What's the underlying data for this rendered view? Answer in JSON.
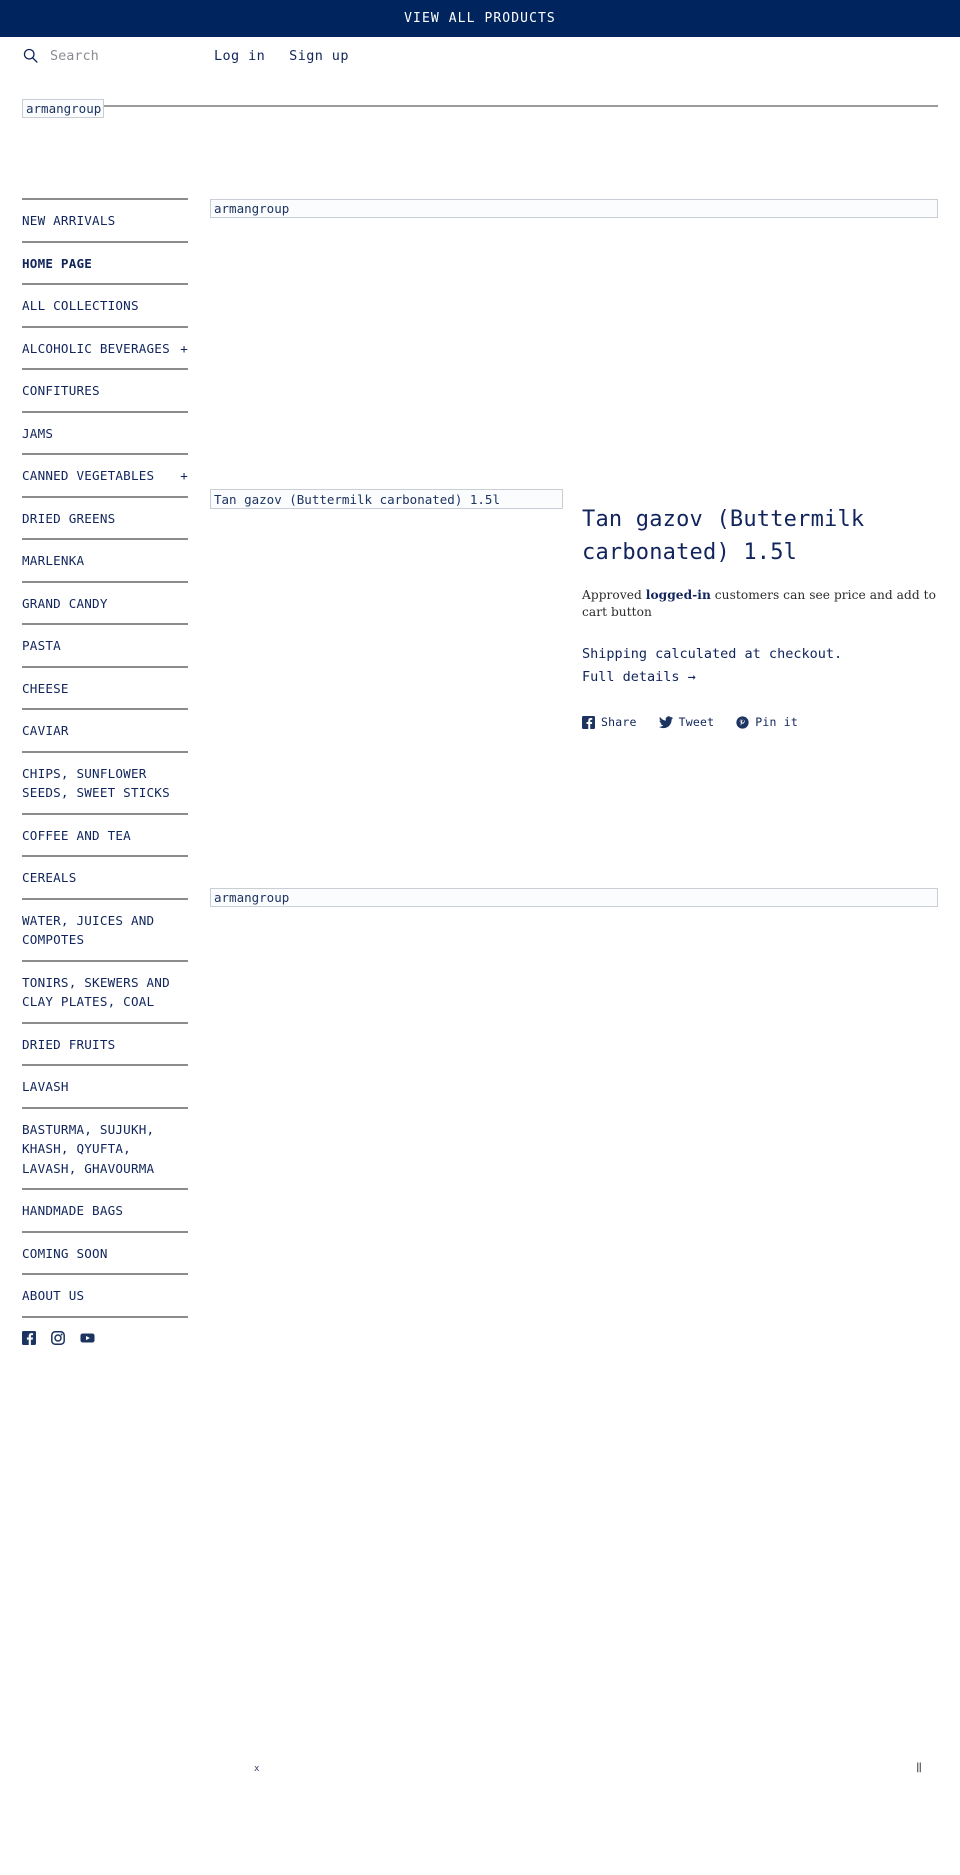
{
  "announcement": {
    "label": "VIEW ALL PRODUCTS"
  },
  "header": {
    "search_placeholder": "Search",
    "search_value": "",
    "search_icon": "search-icon",
    "login_label": "Log in",
    "signup_label": "Sign up",
    "logo_alt": "armangroup"
  },
  "sidebar": {
    "items": [
      {
        "label": "NEW ARRIVALS",
        "expand": "",
        "active": false
      },
      {
        "label": "HOME PAGE",
        "expand": "",
        "active": true
      },
      {
        "label": "ALL COLLECTIONS",
        "expand": "",
        "active": false
      },
      {
        "label": "ALCOHOLIC BEVERAGES",
        "expand": "+",
        "tight": true,
        "active": false
      },
      {
        "label": "CONFITURES",
        "expand": "",
        "active": false
      },
      {
        "label": "JAMS",
        "expand": "",
        "active": false
      },
      {
        "label": "CANNED VEGETABLES",
        "expand": "+",
        "tight": false,
        "active": false
      },
      {
        "label": "DRIED GREENS",
        "expand": "",
        "active": false
      },
      {
        "label": "MARLENKA",
        "expand": "",
        "active": false
      },
      {
        "label": "GRAND CANDY",
        "expand": "",
        "active": false
      },
      {
        "label": "PASTA",
        "expand": "",
        "active": false
      },
      {
        "label": "CHEESE",
        "expand": "",
        "active": false
      },
      {
        "label": "CAVIAR",
        "expand": "",
        "active": false
      },
      {
        "label": "CHIPS, SUNFLOWER SEEDS, SWEET STICKS",
        "expand": "",
        "active": false
      },
      {
        "label": "COFFEE AND TEA",
        "expand": "",
        "active": false
      },
      {
        "label": "CEREALS",
        "expand": "",
        "active": false
      },
      {
        "label": "WATER, JUICES AND COMPOTES",
        "expand": "",
        "active": false
      },
      {
        "label": "TONIRS, SKEWERS AND CLAY PLATES, COAL",
        "expand": "",
        "active": false
      },
      {
        "label": "DRIED FRUITS",
        "expand": "",
        "active": false
      },
      {
        "label": "LAVASH",
        "expand": "",
        "active": false
      },
      {
        "label": "BASTURMA, SUJUKH, KHASH, QYUFTA, LAVASH, GHAVOURMA",
        "expand": "",
        "active": false
      },
      {
        "label": "HANDMADE BAGS",
        "expand": "",
        "active": false
      },
      {
        "label": "COMING SOON",
        "expand": "",
        "active": false
      },
      {
        "label": "ABOUT US",
        "expand": "",
        "active": false
      }
    ],
    "social": [
      {
        "name": "facebook-icon"
      },
      {
        "name": "instagram-icon"
      },
      {
        "name": "youtube-icon"
      }
    ]
  },
  "main": {
    "banner_top_alt": "armangroup",
    "banner_bottom_alt": "armangroup",
    "product_image_alt": "Tan gazov (Buttermilk carbonated) 1.5l",
    "product": {
      "title": "Tan gazov (Buttermilk carbonated) 1.5l",
      "note_prefix": "Approved ",
      "note_bold": "logged-in",
      "note_suffix": " customers can see price and add to cart button",
      "shipping": "Shipping calculated at checkout.",
      "full_details": "Full details →"
    },
    "share": [
      {
        "label": "Share",
        "icon": "facebook-icon"
      },
      {
        "label": "Tweet",
        "icon": "twitter-icon"
      },
      {
        "label": "Pin it",
        "icon": "pinterest-icon"
      }
    ]
  },
  "footer_marks": {
    "left_mark": "x",
    "right_mark": "‖"
  },
  "colors": {
    "navy": "#00245e",
    "text_navy": "#11255c",
    "rule_gray": "#8c8c8c",
    "placeholder_gray": "#8b8b94"
  }
}
